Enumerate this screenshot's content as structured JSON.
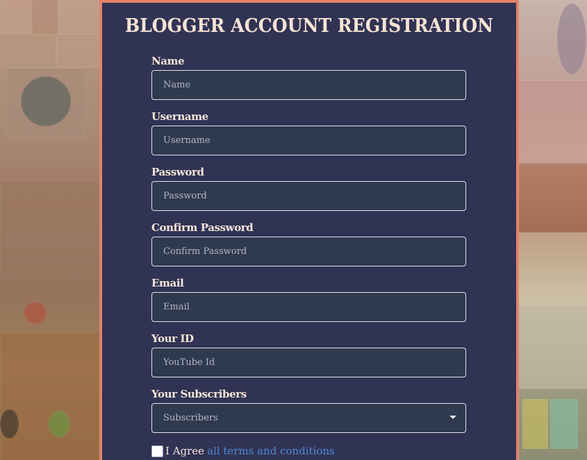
{
  "form": {
    "title": "BLOGGER ACCOUNT REGISTRATION",
    "fields": [
      {
        "label": "Name",
        "placeholder": "Name"
      },
      {
        "label": "Username",
        "placeholder": "Username"
      },
      {
        "label": "Password",
        "placeholder": "Password"
      },
      {
        "label": "Confirm Password",
        "placeholder": "Confirm Password"
      },
      {
        "label": "Email",
        "placeholder": "Email"
      },
      {
        "label": "Your ID",
        "placeholder": "YouTube Id"
      }
    ],
    "subscribers": {
      "label": "Your Subscribers",
      "selected": "Subscribers"
    },
    "agree": {
      "text": "I Agree",
      "link": "all terms and conditions",
      "checked": false
    }
  },
  "colors": {
    "panel": "#313354",
    "border": "#e3836a",
    "input_bg": "#2f3a50",
    "link": "#4a8ad8"
  },
  "icons": [
    "chevron-down-icon"
  ]
}
